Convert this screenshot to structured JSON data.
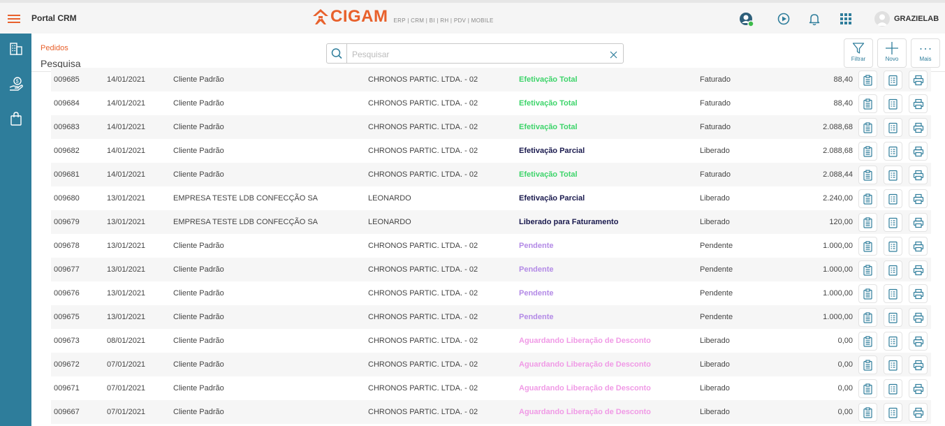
{
  "header": {
    "portal_title": "Portal CRM",
    "logo_text": "CIGAM",
    "logo_sub": "ERP | CRM | BI | RH | PDV | MOBILE",
    "user_name": "GRAZIELAB",
    "accent_color": "#e8612c",
    "icons": [
      "menu-icon",
      "user-status-icon",
      "play-icon",
      "bell-icon",
      "apps-grid-icon",
      "user-avatar-icon"
    ]
  },
  "sidebar": {
    "color": "#2e7d9b",
    "items": [
      {
        "icon": "buildings-icon"
      },
      {
        "icon": "money-hand-icon"
      },
      {
        "icon": "shopping-bag-icon"
      }
    ]
  },
  "subheader": {
    "breadcrumb": "Pedidos",
    "title": "Pesquisa",
    "search_placeholder": "Pesquisar",
    "search_value": "",
    "buttons": {
      "filter": "Filtrar",
      "new": "Novo",
      "more": "Mais"
    }
  },
  "status_colors": {
    "Efetivação Total": "#3dd46a",
    "Efetivação Parcial": "#1a1a4e",
    "Liberado para Faturamento": "#1a1a4e",
    "Pendente": "#b38ae6",
    "Aguardando Liberação de Desconto": "#f09ae6"
  },
  "orders": [
    {
      "number": "009685",
      "date": "14/01/2021",
      "client": "Cliente Padrão",
      "company": "CHRONOS PARTIC. LTDA. - 02",
      "status": "Efetivação Total",
      "situation": "Faturado",
      "value": "88,40"
    },
    {
      "number": "009684",
      "date": "14/01/2021",
      "client": "Cliente Padrão",
      "company": "CHRONOS PARTIC. LTDA. - 02",
      "status": "Efetivação Total",
      "situation": "Faturado",
      "value": "88,40"
    },
    {
      "number": "009683",
      "date": "14/01/2021",
      "client": "Cliente Padrão",
      "company": "CHRONOS PARTIC. LTDA. - 02",
      "status": "Efetivação Total",
      "situation": "Faturado",
      "value": "2.088,68"
    },
    {
      "number": "009682",
      "date": "14/01/2021",
      "client": "Cliente Padrão",
      "company": "CHRONOS PARTIC. LTDA. - 02",
      "status": "Efetivação Parcial",
      "situation": "Liberado",
      "value": "2.088,68"
    },
    {
      "number": "009681",
      "date": "14/01/2021",
      "client": "Cliente Padrão",
      "company": "CHRONOS PARTIC. LTDA. - 02",
      "status": "Efetivação Total",
      "situation": "Faturado",
      "value": "2.088,44"
    },
    {
      "number": "009680",
      "date": "13/01/2021",
      "client": "EMPRESA TESTE LDB CONFECÇÃO SA",
      "company": "LEONARDO",
      "status": "Efetivação Parcial",
      "situation": "Liberado",
      "value": "2.240,00"
    },
    {
      "number": "009679",
      "date": "13/01/2021",
      "client": "EMPRESA TESTE LDB CONFECÇÃO SA",
      "company": "LEONARDO",
      "status": "Liberado para Faturamento",
      "situation": "Liberado",
      "value": "120,00"
    },
    {
      "number": "009678",
      "date": "13/01/2021",
      "client": "Cliente Padrão",
      "company": "CHRONOS PARTIC. LTDA. - 02",
      "status": "Pendente",
      "situation": "Pendente",
      "value": "1.000,00"
    },
    {
      "number": "009677",
      "date": "13/01/2021",
      "client": "Cliente Padrão",
      "company": "CHRONOS PARTIC. LTDA. - 02",
      "status": "Pendente",
      "situation": "Pendente",
      "value": "1.000,00"
    },
    {
      "number": "009676",
      "date": "13/01/2021",
      "client": "Cliente Padrão",
      "company": "CHRONOS PARTIC. LTDA. - 02",
      "status": "Pendente",
      "situation": "Pendente",
      "value": "1.000,00"
    },
    {
      "number": "009675",
      "date": "13/01/2021",
      "client": "Cliente Padrão",
      "company": "CHRONOS PARTIC. LTDA. - 02",
      "status": "Pendente",
      "situation": "Pendente",
      "value": "1.000,00"
    },
    {
      "number": "009673",
      "date": "08/01/2021",
      "client": "Cliente Padrão",
      "company": "CHRONOS PARTIC. LTDA. - 02",
      "status": "Aguardando Liberação de Desconto",
      "situation": "Liberado",
      "value": "0,00"
    },
    {
      "number": "009672",
      "date": "07/01/2021",
      "client": "Cliente Padrão",
      "company": "CHRONOS PARTIC. LTDA. - 02",
      "status": "Aguardando Liberação de Desconto",
      "situation": "Liberado",
      "value": "0,00"
    },
    {
      "number": "009671",
      "date": "07/01/2021",
      "client": "Cliente Padrão",
      "company": "CHRONOS PARTIC. LTDA. - 02",
      "status": "Aguardando Liberação de Desconto",
      "situation": "Liberado",
      "value": "0,00"
    },
    {
      "number": "009667",
      "date": "07/01/2021",
      "client": "Cliente Padrão",
      "company": "CHRONOS PARTIC. LTDA. - 02",
      "status": "Aguardando Liberação de Desconto",
      "situation": "Liberado",
      "value": "0,00"
    }
  ]
}
